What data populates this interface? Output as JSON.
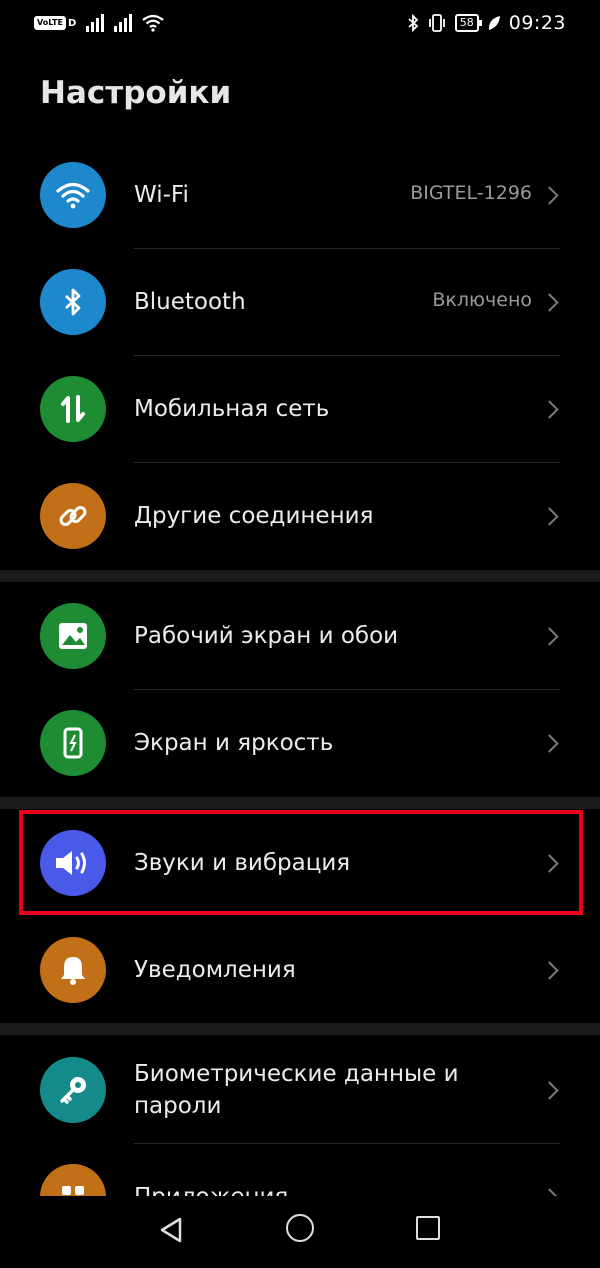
{
  "status_bar": {
    "volte_label": "VoLTE",
    "volte_sub": "D",
    "battery": "58",
    "time": "09:23"
  },
  "page_title": "Настройки",
  "highlight_color": "#e8001b",
  "items": [
    {
      "label": "Wi-Fi",
      "value": "BIGTEL-1296",
      "icon": "wifi-icon",
      "color": "#1e88cc"
    },
    {
      "label": "Bluetooth",
      "value": "Включено",
      "icon": "bluetooth-icon",
      "color": "#1e88cc"
    },
    {
      "label": "Мобильная сеть",
      "value": "",
      "icon": "mobile-data-icon",
      "color": "#1e8c32"
    },
    {
      "label": "Другие соединения",
      "value": "",
      "icon": "link-icon",
      "color": "#c27018"
    },
    {
      "label": "Рабочий экран и обои",
      "value": "",
      "icon": "wallpaper-icon",
      "color": "#1e8c32"
    },
    {
      "label": "Экран и яркость",
      "value": "",
      "icon": "display-icon",
      "color": "#1e8c32"
    },
    {
      "label": "Звуки и вибрация",
      "value": "",
      "icon": "sound-icon",
      "color": "#4a5ae8"
    },
    {
      "label": "Уведомления",
      "value": "",
      "icon": "bell-icon",
      "color": "#c27018"
    },
    {
      "label": "Биометрические данные и пароли",
      "value": "",
      "icon": "key-icon",
      "color": "#158a8a"
    },
    {
      "label": "Приложения",
      "value": "",
      "icon": "apps-icon",
      "color": "#c27018"
    }
  ],
  "navigation": {
    "back": "back-icon",
    "home": "home-icon",
    "recents": "recents-icon"
  }
}
